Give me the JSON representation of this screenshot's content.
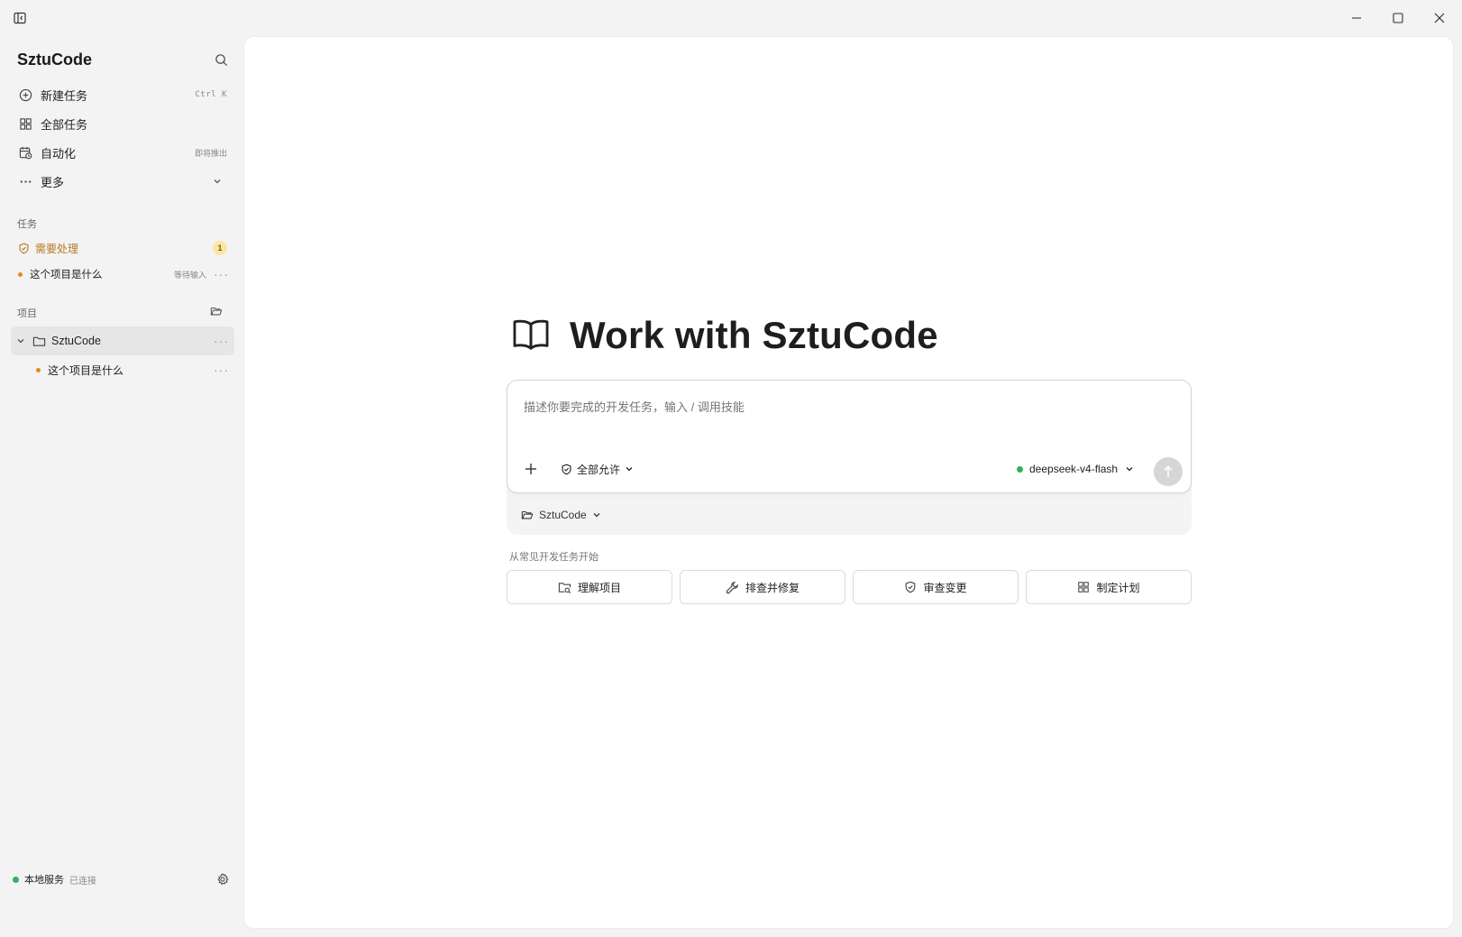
{
  "titlebar": {
    "toggle_icon": "sidebar-toggle-icon",
    "minimize_icon": "minimize-icon",
    "maximize_icon": "maximize-icon",
    "close_icon": "close-icon"
  },
  "sidebar": {
    "brand": "SztuCode",
    "nav": [
      {
        "label": "新建任务",
        "shortcut": "Ctrl K",
        "icon": "plus-circle-icon"
      },
      {
        "label": "全部任务",
        "icon": "grid-icon"
      },
      {
        "label": "自动化",
        "tag": "即将推出",
        "icon": "calendar-clock-icon"
      },
      {
        "label": "更多",
        "icon": "ellipsis-icon"
      }
    ],
    "tasks_section": "任务",
    "needs_attention": {
      "label": "需要处理",
      "count": "1"
    },
    "task_item": {
      "label": "这个项目是什么",
      "status": "等待输入"
    },
    "projects_section": "项目",
    "project": {
      "name": "SztuCode"
    },
    "project_task": {
      "label": "这个项目是什么"
    },
    "footer": {
      "service_label": "本地服务",
      "service_status": "已连接"
    }
  },
  "main": {
    "hero_title": "Work with SztuCode",
    "composer": {
      "placeholder": "描述你要完成的开发任务，输入 / 调用技能",
      "permission_label": "全部允许",
      "model_label": "deepseek-v4-flash",
      "project_selector": "SztuCode"
    },
    "starters_label": "从常见开发任务开始",
    "starters": [
      {
        "label": "理解项目",
        "icon": "folder-search-icon"
      },
      {
        "label": "排查并修复",
        "icon": "wrench-icon"
      },
      {
        "label": "审查变更",
        "icon": "shield-icon"
      },
      {
        "label": "制定计划",
        "icon": "layout-grid-icon"
      }
    ]
  },
  "colors": {
    "accent_green": "#2fb35b",
    "attention_amber": "#b7791f",
    "dot_orange": "#e08a1e"
  }
}
